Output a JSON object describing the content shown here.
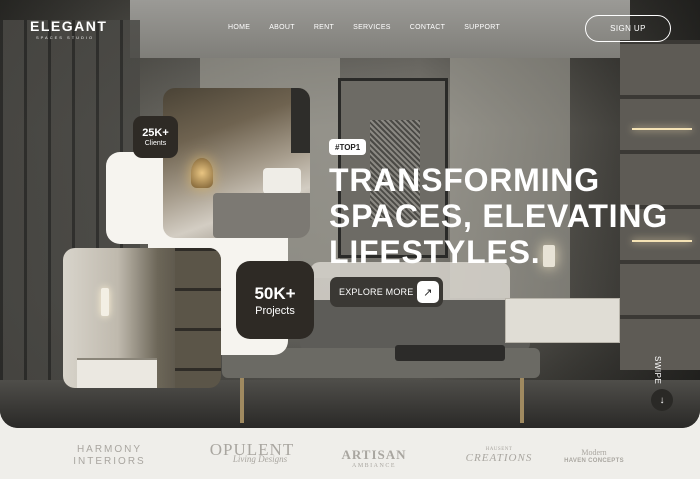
{
  "brand": {
    "name": "ELEGANT",
    "tagline": "SPACES STUDIO"
  },
  "nav": {
    "items": [
      "HOME",
      "ABOUT",
      "RENT",
      "SERVICES",
      "CONTACT",
      "SUPPORT"
    ]
  },
  "header": {
    "signup_label": "SIGN UP"
  },
  "hero": {
    "badge": "#TOP1",
    "headline": [
      "TRANSFORMING",
      "SPACES, ELEVATING",
      "LIFESTYLES."
    ],
    "cta_label": "EXPLORE MORE",
    "cta_icon": "↗",
    "swipe_label": "SWIPE",
    "swipe_icon": "↓"
  },
  "stats": [
    {
      "value": "25K+",
      "label": "Clients"
    },
    {
      "value": "50K+",
      "label": "Projects"
    }
  ],
  "partners": [
    {
      "line1": "HARMONY",
      "line2": "INTERIORS"
    },
    {
      "line1": "OPULENT",
      "line2": "Living Designs"
    },
    {
      "line1": "ARTISAN",
      "line2": "AMBIANCE"
    },
    {
      "line1": "HAUSENT",
      "line2": "CREATIONS"
    },
    {
      "line1": "Modern",
      "line2": "HAVEN CONCEPTS"
    }
  ],
  "colors": {
    "dark_card": "#2e2a25",
    "cream": "#f6f4ef",
    "text_light": "#ffffff",
    "partner_gray": "#a9a6a0"
  }
}
